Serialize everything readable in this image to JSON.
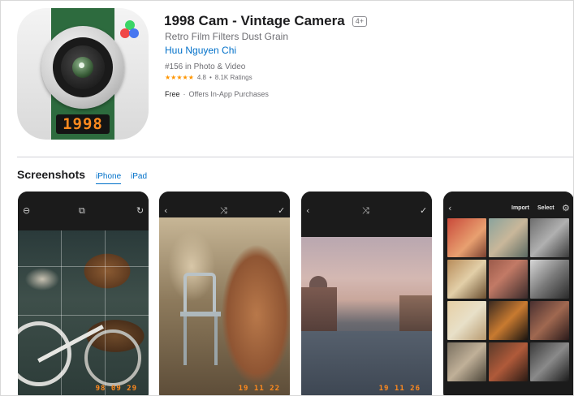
{
  "app": {
    "title": "1998 Cam - Vintage Camera",
    "age_rating": "4+",
    "subtitle": "Retro Film Filters Dust Grain",
    "developer": "Huu Nguyen Chi",
    "ranking": "#156 in Photo & Video",
    "stars": "★★★★★",
    "rating": "4.8",
    "rating_sep": "•",
    "ratings_count": "8.1K Ratings",
    "price": "Free",
    "price_sep": "·",
    "in_app": "Offers In-App Purchases",
    "icon_counter": "1998"
  },
  "screenshots": {
    "title": "Screenshots",
    "tabs": [
      {
        "label": "iPhone",
        "selected": true
      },
      {
        "label": "iPad",
        "selected": false
      }
    ],
    "items": [
      {
        "caption": "",
        "date_stamp": "98 09 29"
      },
      {
        "caption": "",
        "date_stamp": "19 11 22"
      },
      {
        "caption": "",
        "date_stamp": "19 11 26"
      },
      {
        "import_label": "Import",
        "select_label": "Select"
      }
    ]
  },
  "colors": {
    "link": "#0070c9",
    "stars": "#ff9500",
    "icon_green": "#2d6b3e",
    "date_stamp": "#ff8a1e"
  },
  "icons": {
    "shot1_top": [
      "circle-minus-icon",
      "crop-icon",
      "refresh-icon"
    ],
    "shot2_top": [
      "back-chevron-icon",
      "shuffle-icon",
      "check-icon"
    ],
    "shot3_top": [
      "back-chevron-icon",
      "shuffle-icon",
      "check-icon"
    ],
    "shot4_top": [
      "back-chevron-icon",
      "settings-icon"
    ]
  }
}
